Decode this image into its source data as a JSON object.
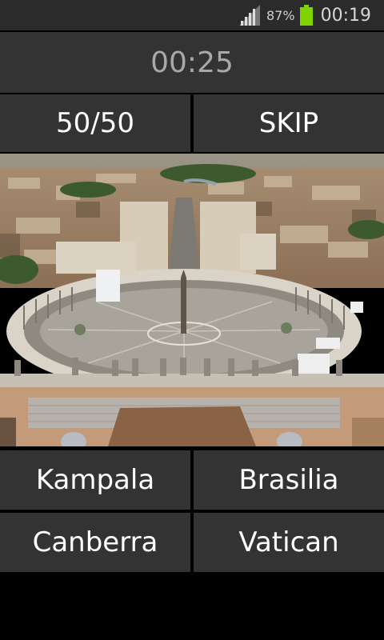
{
  "status_bar": {
    "battery_percent": "87%",
    "time": "00:19",
    "battery_color": "#7fd400",
    "icons": [
      "signal-icon",
      "battery-icon"
    ]
  },
  "quiz": {
    "timer": "00:25",
    "lifelines": {
      "fifty_fifty": "50/50",
      "skip": "SKIP"
    },
    "answers": [
      "Kampala",
      "Brasilia",
      "Canberra",
      "Vatican"
    ]
  },
  "colors": {
    "background": "#000000",
    "button": "#333333",
    "button_text": "#ffffff",
    "timer_text": "#a8a8a8"
  }
}
